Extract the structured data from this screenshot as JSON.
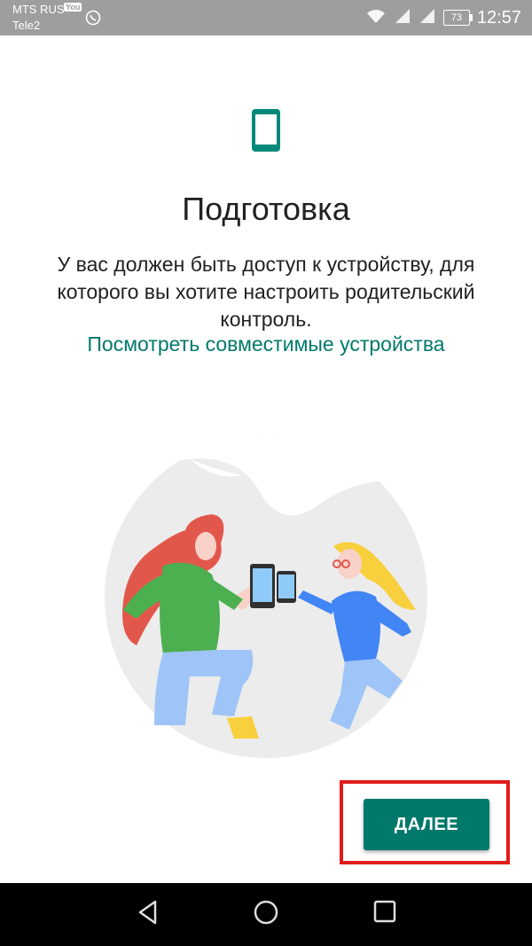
{
  "status_bar": {
    "carrier_primary": "MTS RUS",
    "carrier_secondary": "Tele2",
    "badge": "YouTube",
    "battery": "73",
    "time": "12:57"
  },
  "setup": {
    "title": "Подготовка",
    "description": "У вас должен быть доступ к устройству, для которого вы хотите настроить родительский контроль.",
    "link": "Посмотреть совместимые устройства",
    "next_button": "ДАЛЕЕ"
  },
  "colors": {
    "accent": "#00796b",
    "highlight": "#e21b1b"
  },
  "nav_bar": {
    "icons": [
      "back-icon",
      "home-icon",
      "recents-icon"
    ]
  }
}
